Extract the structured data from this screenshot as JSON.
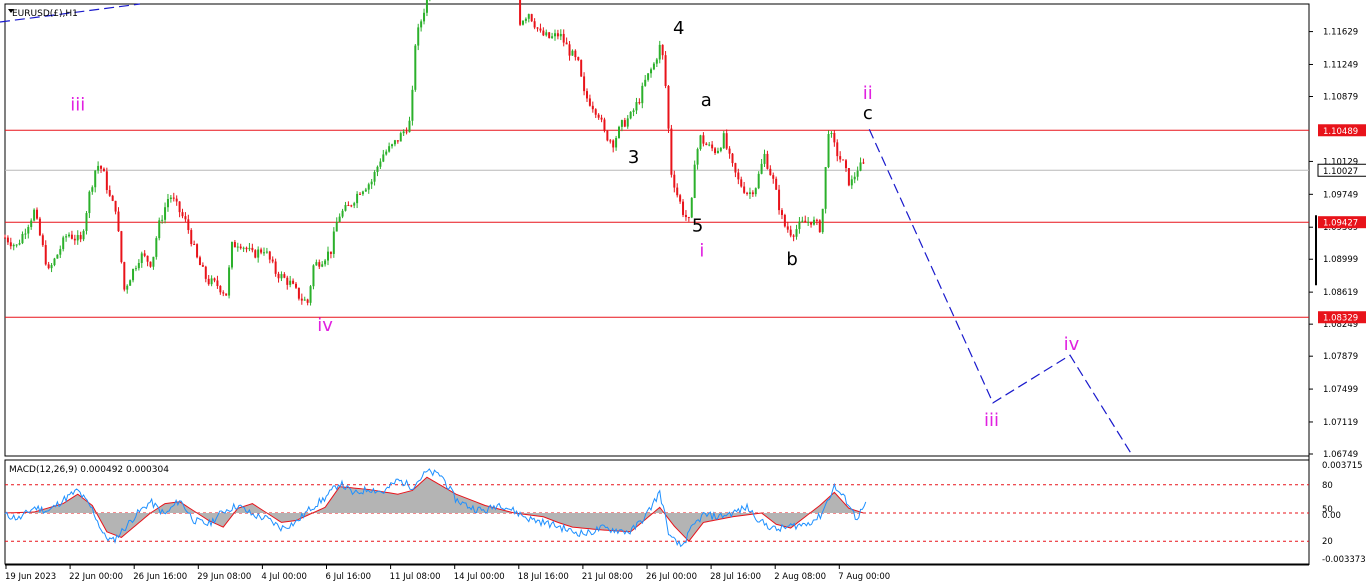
{
  "chart_data": {
    "type": "candlestick",
    "symbol_label": "EURUSD(£),H1",
    "price_axis": {
      "min": 1.06749,
      "max": 1.11809,
      "ticks": [
        "1.11629",
        "1.11249",
        "1.10879",
        "1.10129",
        "1.09749",
        "1.09369",
        "1.08999",
        "1.08619",
        "1.08249",
        "1.07879",
        "1.07499",
        "1.07119",
        "1.06749"
      ]
    },
    "current_price": {
      "value": 1.10027,
      "label": "1.10027"
    },
    "horizontal_lines": [
      {
        "value": 1.10489,
        "label": "1.10489"
      },
      {
        "value": 1.09427,
        "label": "1.09427"
      },
      {
        "value": 1.08329,
        "label": "1.08329"
      }
    ],
    "time_axis": {
      "labels": [
        "19 Jun 2023",
        "22 Jun 00:00",
        "26 Jun 16:00",
        "29 Jun 08:00",
        "4 Jul 00:00",
        "6 Jul 16:00",
        "11 Jul 08:00",
        "14 Jul 00:00",
        "18 Jul 16:00",
        "21 Jul 08:00",
        "26 Jul 00:00",
        "28 Jul 16:00",
        "2 Aug 08:00",
        "7 Aug 00:00"
      ]
    },
    "price_path": [
      [
        0,
        1.0925
      ],
      [
        0.8,
        1.0915
      ],
      [
        2.0,
        1.0955
      ],
      [
        3.0,
        1.0885
      ],
      [
        4.3,
        1.093
      ],
      [
        5.2,
        1.092
      ],
      [
        5.8,
        1.0975
      ],
      [
        6.3,
        1.101
      ],
      [
        6.7,
        1.1003
      ],
      [
        7.3,
        1.0965
      ],
      [
        7.6,
        1.096
      ],
      [
        8.2,
        1.0865
      ],
      [
        8.6,
        1.088
      ],
      [
        9.3,
        1.0905
      ],
      [
        10.1,
        1.0895
      ],
      [
        10.5,
        1.0935
      ],
      [
        11.3,
        1.0975
      ],
      [
        12.0,
        1.0955
      ],
      [
        12.5,
        1.094
      ],
      [
        13.2,
        1.09
      ],
      [
        13.9,
        1.0875
      ],
      [
        14.6,
        1.087
      ],
      [
        15.2,
        1.086
      ],
      [
        15.6,
        1.0915
      ],
      [
        16.1,
        1.092
      ],
      [
        17.0,
        1.0905
      ],
      [
        17.8,
        1.0912
      ],
      [
        18.6,
        1.0885
      ],
      [
        19.6,
        1.0872
      ],
      [
        20.3,
        1.0855
      ],
      [
        20.8,
        1.085
      ],
      [
        21.2,
        1.0892
      ],
      [
        21.8,
        1.09
      ],
      [
        22.4,
        1.091
      ],
      [
        22.9,
        1.095
      ],
      [
        23.6,
        1.096
      ],
      [
        24.4,
        1.098
      ],
      [
        25.2,
        1.099
      ],
      [
        25.9,
        1.102
      ],
      [
        26.6,
        1.103
      ],
      [
        27.3,
        1.1045
      ],
      [
        27.9,
        1.106
      ],
      [
        28.2,
        1.115
      ],
      [
        28.9,
        1.1195
      ],
      [
        29.5,
        1.122
      ],
      [
        29.8,
        1.125
      ],
      [
        30.6,
        1.128
      ],
      [
        31.6,
        1.127
      ],
      [
        32.3,
        1.1245
      ],
      [
        33.0,
        1.123
      ],
      [
        34.0,
        1.126
      ],
      [
        35.0,
        1.127
      ],
      [
        35.4,
        1.1175
      ],
      [
        36.0,
        1.1185
      ],
      [
        36.8,
        1.116
      ],
      [
        37.5,
        1.1155
      ],
      [
        38.1,
        1.116
      ],
      [
        38.8,
        1.114
      ],
      [
        39.4,
        1.1125
      ],
      [
        39.8,
        1.109
      ],
      [
        40.3,
        1.108
      ],
      [
        40.8,
        1.1068
      ],
      [
        41.2,
        1.1045
      ],
      [
        41.8,
        1.1035
      ],
      [
        42.4,
        1.1055
      ],
      [
        43.0,
        1.1065
      ],
      [
        43.6,
        1.1085
      ],
      [
        44.0,
        1.1105
      ],
      [
        44.6,
        1.1125
      ],
      [
        45.1,
        1.115
      ],
      [
        45.4,
        1.11
      ],
      [
        45.8,
        1.1
      ],
      [
        46.2,
        1.0975
      ],
      [
        46.6,
        1.0955
      ],
      [
        47.1,
        1.094
      ],
      [
        47.4,
        1.1015
      ],
      [
        47.8,
        1.104
      ],
      [
        48.3,
        1.103
      ],
      [
        48.9,
        1.1025
      ],
      [
        49.4,
        1.104
      ],
      [
        49.9,
        1.101
      ],
      [
        50.4,
        1.099
      ],
      [
        51.1,
        1.0975
      ],
      [
        51.6,
        1.0985
      ],
      [
        52.2,
        1.102
      ],
      [
        52.8,
        1.099
      ],
      [
        53.5,
        1.094
      ],
      [
        54.1,
        1.093
      ],
      [
        54.7,
        1.094
      ],
      [
        55.4,
        1.0945
      ],
      [
        56.1,
        1.0935
      ],
      [
        56.6,
        1.105
      ],
      [
        57.1,
        1.1025
      ],
      [
        57.6,
        1.101
      ],
      [
        58.1,
        1.0985
      ],
      [
        58.6,
        1.1005
      ],
      [
        59.2,
        1.101
      ]
    ],
    "wave_labels": [
      {
        "text": "4",
        "t": 46.3,
        "price": 1.116
      },
      {
        "text": "a",
        "t": 48.2,
        "price": 1.1077
      },
      {
        "text": "ii",
        "t": 59.3,
        "price": 1.1085
      },
      {
        "text": "c",
        "t": 59.3,
        "price": 1.1062
      },
      {
        "text": "iii",
        "t": 5.0,
        "price": 1.1072
      },
      {
        "text": "3",
        "t": 43.2,
        "price": 1.1011
      },
      {
        "text": "5",
        "t": 47.6,
        "price": 1.0932
      },
      {
        "text": "i",
        "t": 47.9,
        "price": 1.0903
      },
      {
        "text": "b",
        "t": 54.1,
        "price": 1.0893
      },
      {
        "text": "iv",
        "t": 22.0,
        "price": 1.0817
      },
      {
        "text": "iii",
        "t": 67.8,
        "price": 1.0707
      },
      {
        "text": "iv",
        "t": 73.3,
        "price": 1.0795
      }
    ],
    "projection": [
      [
        59.4,
        1.105
      ],
      [
        67.9,
        1.0734
      ],
      [
        73.2,
        1.0789
      ],
      [
        77.5,
        1.0672
      ]
    ],
    "macd": {
      "label": "MACD(12,26,9) 0.000492 0.000304",
      "ylim": [
        -0.003373,
        0.003715
      ],
      "ticks": [
        "0.003715",
        "80",
        "50",
        "0.00",
        "20",
        "-0.003373"
      ],
      "level_lines": [
        80,
        50,
        20
      ],
      "signal": [
        [
          0,
          50
        ],
        [
          2,
          51
        ],
        [
          4,
          60
        ],
        [
          5,
          70
        ],
        [
          6,
          58
        ],
        [
          7,
          30
        ],
        [
          8,
          24
        ],
        [
          10,
          50
        ],
        [
          11,
          60
        ],
        [
          12,
          62
        ],
        [
          14,
          42
        ],
        [
          15,
          35
        ],
        [
          16,
          55
        ],
        [
          17,
          60
        ],
        [
          19,
          40
        ],
        [
          20,
          42
        ],
        [
          22,
          56
        ],
        [
          23,
          78
        ],
        [
          25,
          75
        ],
        [
          27,
          70
        ],
        [
          28,
          74
        ],
        [
          29,
          88
        ],
        [
          31,
          70
        ],
        [
          33,
          58
        ],
        [
          35,
          50
        ],
        [
          37,
          46
        ],
        [
          38,
          40
        ],
        [
          39,
          35
        ],
        [
          41,
          32
        ],
        [
          43,
          30
        ],
        [
          45,
          56
        ],
        [
          46,
          36
        ],
        [
          47,
          20
        ],
        [
          48,
          40
        ],
        [
          50,
          46
        ],
        [
          52,
          50
        ],
        [
          53,
          38
        ],
        [
          54,
          34
        ],
        [
          56,
          58
        ],
        [
          57,
          72
        ],
        [
          58,
          55
        ],
        [
          59,
          50
        ]
      ],
      "main": [
        [
          0,
          48
        ],
        [
          1,
          44
        ],
        [
          2,
          56
        ],
        [
          3,
          52
        ],
        [
          4,
          64
        ],
        [
          5,
          74
        ],
        [
          6,
          54
        ],
        [
          6.8,
          26
        ],
        [
          7.4,
          20
        ],
        [
          8,
          30
        ],
        [
          9,
          48
        ],
        [
          10,
          62
        ],
        [
          11,
          48
        ],
        [
          12,
          64
        ],
        [
          13,
          42
        ],
        [
          14,
          38
        ],
        [
          15,
          52
        ],
        [
          16,
          58
        ],
        [
          17,
          48
        ],
        [
          18,
          44
        ],
        [
          19,
          34
        ],
        [
          20,
          40
        ],
        [
          21,
          55
        ],
        [
          22,
          66
        ],
        [
          23,
          82
        ],
        [
          24,
          70
        ],
        [
          25,
          76
        ],
        [
          26,
          72
        ],
        [
          27,
          85
        ],
        [
          28,
          78
        ],
        [
          29,
          94
        ],
        [
          30,
          90
        ],
        [
          31,
          64
        ],
        [
          32,
          56
        ],
        [
          33,
          52
        ],
        [
          34,
          60
        ],
        [
          35,
          52
        ],
        [
          36,
          44
        ],
        [
          37,
          40
        ],
        [
          38,
          36
        ],
        [
          39,
          30
        ],
        [
          40,
          28
        ],
        [
          41,
          34
        ],
        [
          42,
          32
        ],
        [
          43,
          30
        ],
        [
          44,
          46
        ],
        [
          45,
          72
        ],
        [
          45.7,
          24
        ],
        [
          46.5,
          14
        ],
        [
          47.3,
          36
        ],
        [
          48,
          48
        ],
        [
          49,
          46
        ],
        [
          50,
          50
        ],
        [
          51,
          56
        ],
        [
          52,
          40
        ],
        [
          53,
          32
        ],
        [
          54,
          36
        ],
        [
          55,
          38
        ],
        [
          56,
          46
        ],
        [
          57,
          78
        ],
        [
          58,
          60
        ],
        [
          58.5,
          44
        ],
        [
          59.2,
          60
        ]
      ]
    }
  }
}
